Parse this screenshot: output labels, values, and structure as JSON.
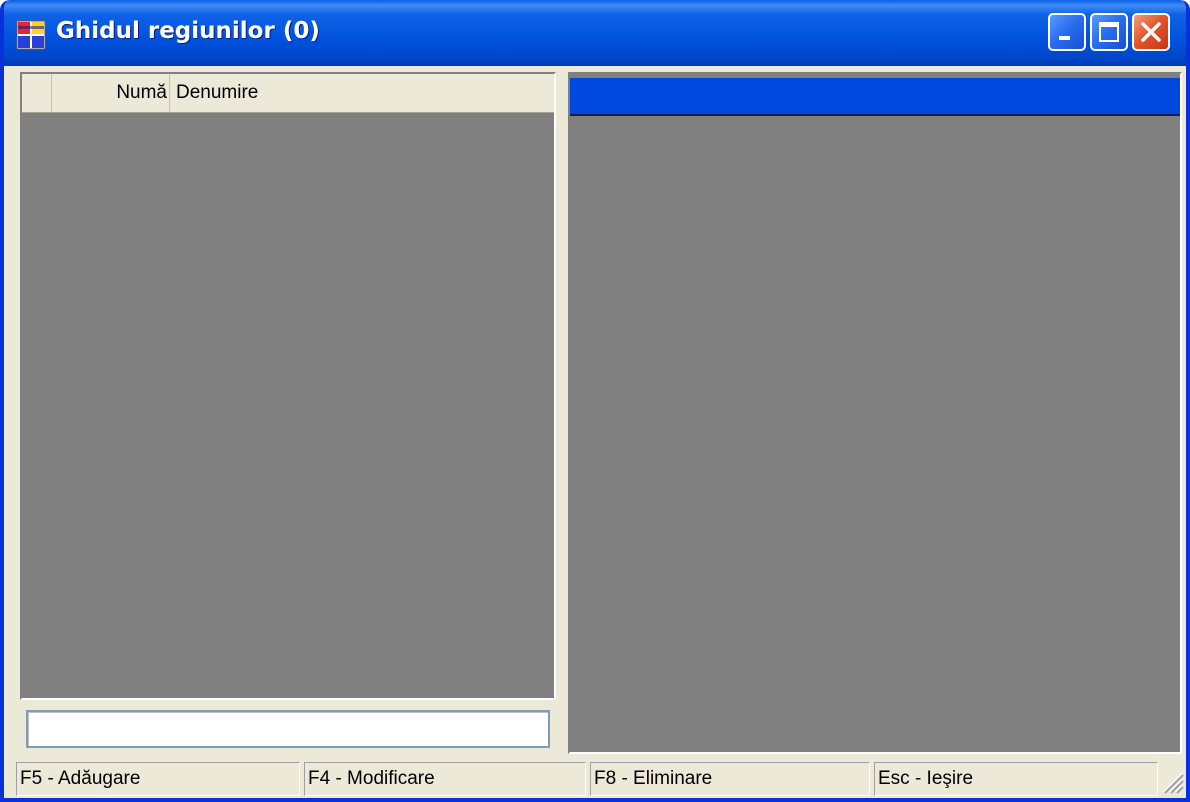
{
  "window": {
    "title": "Ghidul regiunilor (0)",
    "icon": "app-window-icon",
    "controls": {
      "minimize_icon": "minimize-icon",
      "maximize_icon": "maximize-icon",
      "close_icon": "close-icon"
    }
  },
  "grid": {
    "columns": [
      {
        "key": "row_selector",
        "label": ""
      },
      {
        "key": "numar",
        "label": "Numă"
      },
      {
        "key": "denumire",
        "label": "Denumire"
      }
    ],
    "rows": []
  },
  "search": {
    "value": "",
    "placeholder": ""
  },
  "statusbar": {
    "items": [
      {
        "label": "F5 - Adăugare"
      },
      {
        "label": "F4 - Modificare"
      },
      {
        "label": "F8 - Eliminare"
      },
      {
        "label": "Esc - Ieşire"
      }
    ],
    "grip_icon": "resize-grip-icon"
  },
  "colors": {
    "titlebar": "#0052de",
    "panel_background": "#808080",
    "selection_header": "#0049e0",
    "window_face": "#ece9d8"
  }
}
